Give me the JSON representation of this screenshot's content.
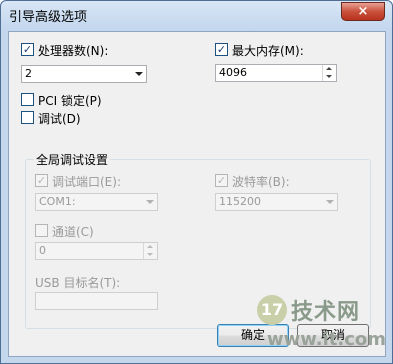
{
  "window": {
    "title": "引导高级选项",
    "close_glyph": "×"
  },
  "processors": {
    "label": "处理器数(N):",
    "checked": true,
    "check_glyph": "✓",
    "value": "2"
  },
  "max_memory": {
    "label": "最大内存(M):",
    "checked": true,
    "check_glyph": "✓",
    "value": "4096"
  },
  "pci_lock": {
    "label": "PCI 锁定(P)",
    "checked": false
  },
  "debug": {
    "label": "调试(D)",
    "checked": false
  },
  "global_debug": {
    "title": "全局调试设置",
    "debug_port": {
      "label": "调试端口(E):",
      "checked": true,
      "check_glyph": "✓",
      "value": "COM1:"
    },
    "baud_rate": {
      "label": "波特率(B):",
      "checked": true,
      "check_glyph": "✓",
      "value": "115200"
    },
    "channel": {
      "label": "通道(C)",
      "checked": false,
      "value": "0"
    },
    "usb_target": {
      "label": "USB 目标名(T):",
      "value": ""
    }
  },
  "buttons": {
    "ok": "确定",
    "cancel": "取消"
  },
  "watermark": {
    "logo": "17",
    "text": "技术网",
    "url": "www.it",
    "suffix": "com"
  }
}
